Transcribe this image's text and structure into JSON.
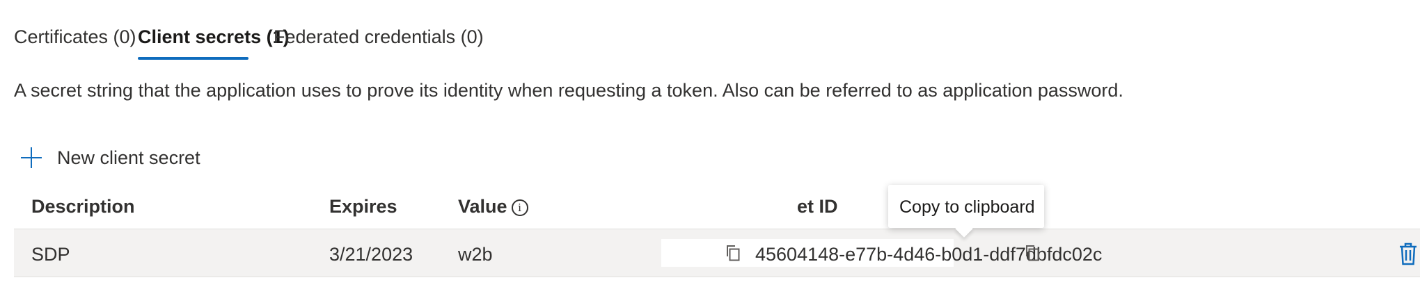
{
  "tabs": [
    {
      "label": "Certificates (0)"
    },
    {
      "label": "Client secrets (1)"
    },
    {
      "label": "Federated credentials (0)"
    }
  ],
  "active_tab": "Client secrets (1)",
  "description": "A secret string that the application uses to prove its identity when requesting a token. Also can be referred to as application password.",
  "new_secret_label": "New client secret",
  "table": {
    "headers": {
      "description": "Description",
      "expires": "Expires",
      "value": "Value",
      "secret_id": "et ID"
    },
    "rows": [
      {
        "description": "SDP",
        "expires": "3/21/2023",
        "value_visible": "w2b",
        "secret_id": "45604148-e77b-4d46-b0d1-ddf7dbfdc02c"
      }
    ]
  },
  "tooltip": "Copy to clipboard",
  "icons": {
    "add": "plus-icon",
    "info": "info-icon",
    "copy": "copy-icon",
    "delete": "trash-icon"
  },
  "colors": {
    "accent": "#0f6cbd",
    "row_background": "#f3f2f1"
  }
}
